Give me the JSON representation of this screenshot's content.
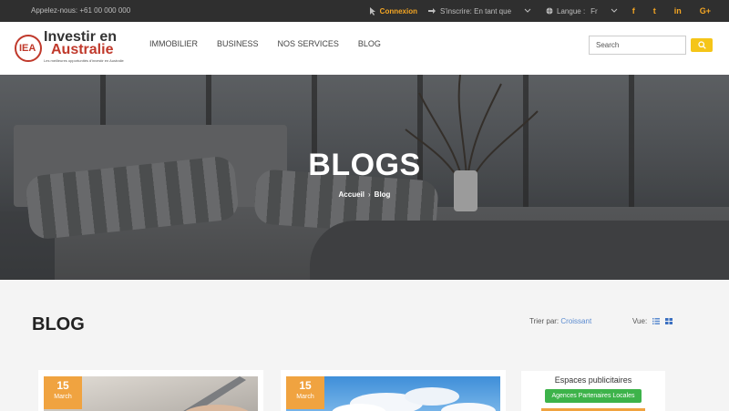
{
  "topbar": {
    "phone": "Appelez-nous: +61 00 000 000",
    "login": "Connexion",
    "register": "S'inscrire: En tant que",
    "language_label": "Langue :",
    "language_value": "Fr",
    "social": [
      "facebook-icon",
      "twitter-icon",
      "linkedin-icon",
      "googleplus-icon"
    ],
    "social_glyphs": [
      "f",
      "t",
      "in",
      "G+"
    ]
  },
  "logo": {
    "badge": "IEA",
    "line1": "Investir en",
    "line2": "Australie",
    "tagline": "Les meilleures opportunités d'investir en Australie"
  },
  "nav": {
    "items": [
      "IMMOBILIER",
      "BUSINESS",
      "NOS SERVICES",
      "BLOG"
    ]
  },
  "search": {
    "placeholder": "Search"
  },
  "hero": {
    "title": "BLOGS",
    "breadcrumb_home": "Accueil",
    "breadcrumb_sep": "›",
    "breadcrumb_current": "Blog"
  },
  "content": {
    "title": "BLOG",
    "sort_label": "Trier par:",
    "sort_value": "Croissant",
    "view_label": "Vue:"
  },
  "cards": [
    {
      "day": "15",
      "month": "March"
    },
    {
      "day": "15",
      "month": "March"
    }
  ],
  "ads": {
    "title": "Espaces publicitaires",
    "button": "Agences Partenaires Locales"
  },
  "colors": {
    "accent": "#f5a623",
    "date_badge": "#f0a340",
    "green": "#3db34a",
    "topbar": "#2f2f2f"
  }
}
